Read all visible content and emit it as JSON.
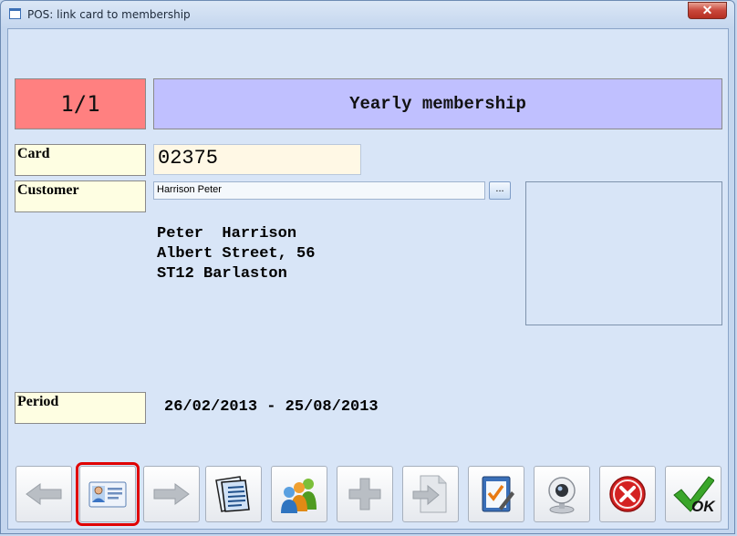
{
  "window": {
    "title": "POS: link card to membership",
    "close_glyph": "✕"
  },
  "record": {
    "counter": "1/1",
    "membership_name": "Yearly membership"
  },
  "card": {
    "label": "Card",
    "value": "02375"
  },
  "customer": {
    "label": "Customer",
    "value": "Harrison Peter",
    "browse_label": "...",
    "address_line1": "Peter  Harrison",
    "address_line2": "Albert Street, 56",
    "address_line3": "ST12 Barlaston"
  },
  "period": {
    "label": "Period",
    "value": "26/02/2013 - 25/08/2013"
  },
  "toolbar": {
    "ok_label": "OK",
    "buttons": [
      {
        "icon": "arrow-left-icon",
        "enabled": false
      },
      {
        "icon": "id-card-icon",
        "enabled": true,
        "selected": true
      },
      {
        "icon": "arrow-right-icon",
        "enabled": false
      },
      {
        "icon": "documents-icon",
        "enabled": true
      },
      {
        "icon": "users-group-icon",
        "enabled": true
      },
      {
        "icon": "plus-icon",
        "enabled": false
      },
      {
        "icon": "document-export-icon",
        "enabled": false
      },
      {
        "icon": "clipboard-check-icon",
        "enabled": true
      },
      {
        "icon": "webcam-icon",
        "enabled": true
      },
      {
        "icon": "cancel-icon",
        "enabled": true
      },
      {
        "icon": "ok-check-icon",
        "enabled": true
      }
    ]
  },
  "colors": {
    "counter_bg": "#ff8080",
    "membership_bg": "#c0c0ff",
    "label_bg": "#fefee2",
    "card_bg": "#fff8e5",
    "selection": "#e00000"
  }
}
